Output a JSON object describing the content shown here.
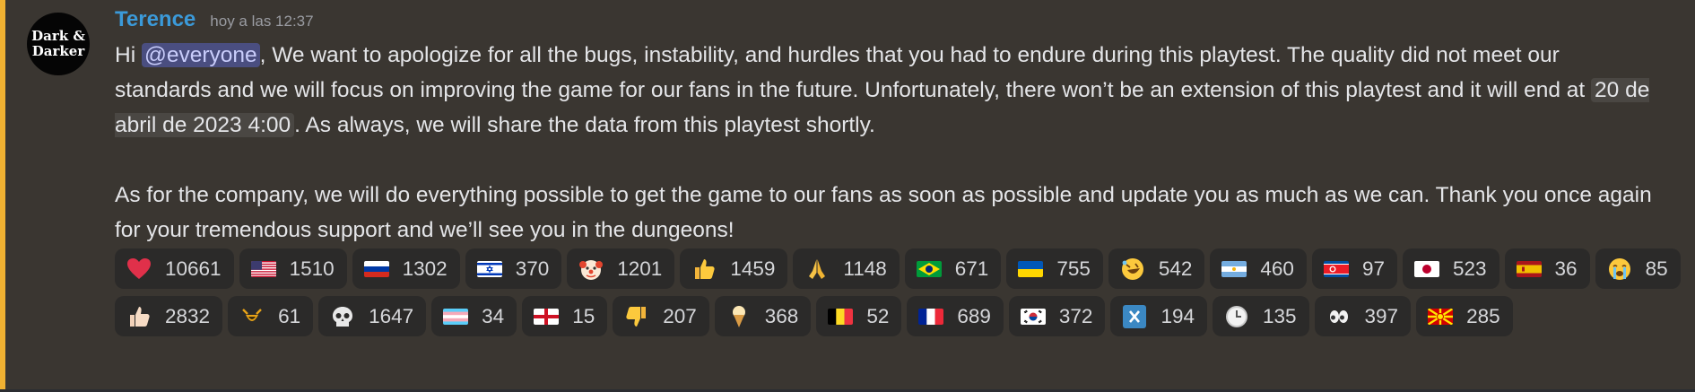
{
  "avatar": {
    "line1": "Dark &",
    "line2": "Darker"
  },
  "author": {
    "name": "Terence",
    "color": "#3b9ad9",
    "timestamp": "hoy a las 12:37"
  },
  "message": {
    "p1_before": "Hi ",
    "mention": "@everyone",
    "p1_after": ", We want to apologize for all the bugs, instability, and hurdles that you had to endure during this playtest. The quality did not meet our standards and we will focus on improving the game for our fans in the future. Unfortunately, there won’t be an extension of this playtest and it will end at ",
    "date": "20 de abril de 2023 4:00",
    "p1_end": ". As always, we will share the data from this playtest shortly.",
    "p2": "As for the company, we will do everything possible to get the game to our fans as soon as possible and update you as much as we can. Thank you once again for your tremendous support and we’ll see you in the dungeons!"
  },
  "reactions": [
    {
      "icon": "heart-icon",
      "count": "10661"
    },
    {
      "icon": "flag-us-icon",
      "count": "1510"
    },
    {
      "icon": "flag-ru-icon",
      "count": "1302"
    },
    {
      "icon": "flag-il-icon",
      "count": "370"
    },
    {
      "icon": "clown-face-icon",
      "count": "1201"
    },
    {
      "icon": "thumbs-up-icon",
      "count": "1459"
    },
    {
      "icon": "folded-hands-icon",
      "count": "1148"
    },
    {
      "icon": "flag-br-icon",
      "count": "671"
    },
    {
      "icon": "flag-ua-icon",
      "count": "755"
    },
    {
      "icon": "rofl-face-icon",
      "count": "542"
    },
    {
      "icon": "flag-ar-icon",
      "count": "460"
    },
    {
      "icon": "flag-kp-icon",
      "count": "97"
    },
    {
      "icon": "flag-jp-icon",
      "count": "523"
    },
    {
      "icon": "flag-es-icon",
      "count": "36"
    },
    {
      "icon": "crying-face-icon",
      "count": "85"
    },
    {
      "icon": "thumbs-up-light-icon",
      "count": "2832"
    },
    {
      "icon": "custom-emote-icon",
      "count": "61"
    },
    {
      "icon": "skull-icon",
      "count": "1647"
    },
    {
      "icon": "flag-transgender-icon",
      "count": "34"
    },
    {
      "icon": "flag-england-icon",
      "count": "15"
    },
    {
      "icon": "thumbs-down-icon",
      "count": "207"
    },
    {
      "icon": "ice-cream-icon",
      "count": "368"
    },
    {
      "icon": "flag-be-icon",
      "count": "52"
    },
    {
      "icon": "flag-fr-icon",
      "count": "689"
    },
    {
      "icon": "flag-kr-icon",
      "count": "372"
    },
    {
      "icon": "x-box-icon",
      "count": "194"
    },
    {
      "icon": "clock-icon",
      "count": "135"
    },
    {
      "icon": "eyes-icon",
      "count": "397"
    },
    {
      "icon": "flag-mk-icon",
      "count": "285"
    }
  ],
  "colors": {
    "mention_bg": "#4a4e80",
    "accent_bar": "#f0b132",
    "background": "#3a3631",
    "reaction_bg": "#2b2a29"
  }
}
